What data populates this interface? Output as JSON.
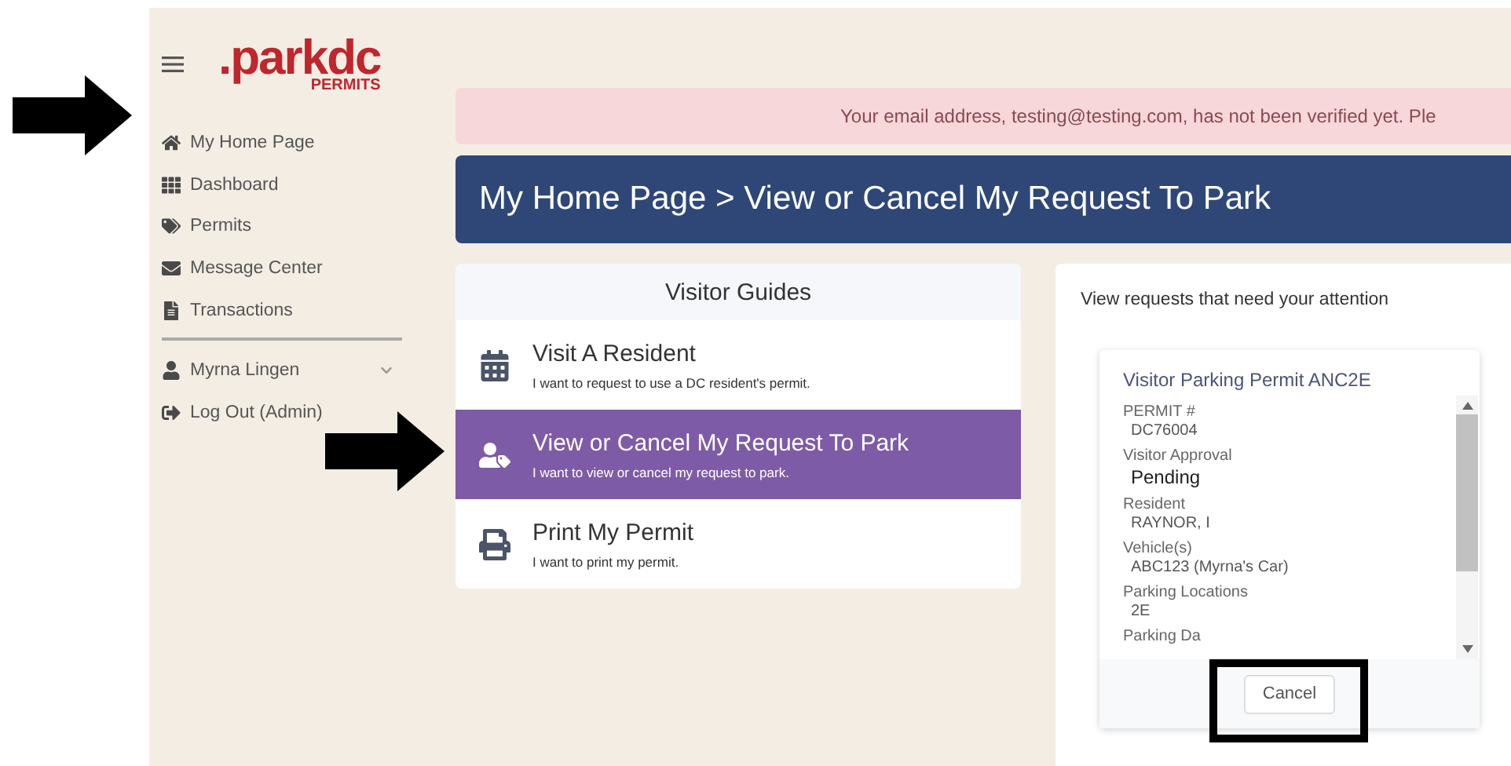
{
  "logo": {
    "word": ".parkdc",
    "tagline": "PERMITS"
  },
  "sidebar": {
    "items": [
      {
        "label": "My Home Page"
      },
      {
        "label": "Dashboard"
      },
      {
        "label": "Permits"
      },
      {
        "label": "Message Center"
      },
      {
        "label": "Transactions"
      }
    ],
    "account": [
      {
        "label": "Myrna Lingen",
        "expanded": false
      },
      {
        "label": "Log Out (Admin)"
      }
    ]
  },
  "alert": "Your email address, testing@testing.com, has not been verified yet. Ple",
  "page_title": "My Home Page > View or Cancel My Request To Park",
  "guides": {
    "title": "Visitor Guides",
    "items": [
      {
        "title": "Visit A Resident",
        "subtitle": "I want to request to use a DC resident's permit.",
        "selected": false
      },
      {
        "title": "View or Cancel My Request To Park",
        "subtitle": "I want to view or cancel my request to park.",
        "selected": true
      },
      {
        "title": "Print My Permit",
        "subtitle": "I want to print my permit.",
        "selected": false
      }
    ]
  },
  "requests": {
    "heading": "View requests that need your attention",
    "card": {
      "title": "Visitor Parking Permit ANC2E",
      "fields": [
        {
          "label": "PERMIT #",
          "value": "DC76004",
          "kind": "plain"
        },
        {
          "label": "Visitor Approval",
          "value": "Pending",
          "kind": "status"
        },
        {
          "label": "Resident",
          "value": "RAYNOR, I",
          "kind": "plain"
        },
        {
          "label": "Vehicle(s)",
          "value": "ABC123 (Myrna's Car)",
          "kind": "plain"
        },
        {
          "label": "Parking Locations",
          "value": "2E",
          "kind": "plain"
        },
        {
          "label": "Parking Da",
          "kind": "cut"
        }
      ],
      "button": "Cancel"
    }
  },
  "annotations": [
    {
      "kind": "arrow"
    },
    {
      "kind": "arrow"
    },
    {
      "kind": "frame"
    }
  ]
}
